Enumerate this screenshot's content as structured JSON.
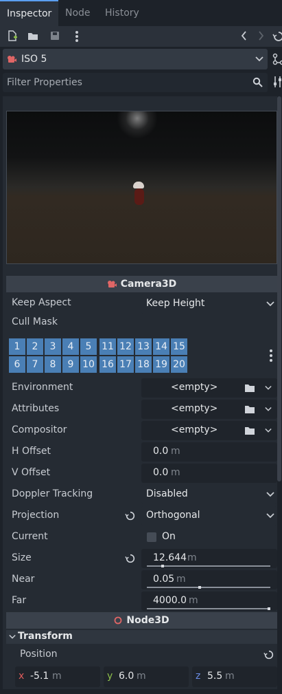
{
  "tabs": [
    "Inspector",
    "Node",
    "History"
  ],
  "node": {
    "name": "ISO 5"
  },
  "filter": {
    "placeholder": "Filter Properties"
  },
  "camera": {
    "header": "Camera3D",
    "keep_aspect": {
      "label": "Keep Aspect",
      "value": "Keep Height"
    },
    "cull_mask": {
      "label": "Cull Mask",
      "layers_row1": [
        "1",
        "2",
        "3",
        "4",
        "5",
        "11",
        "12",
        "13",
        "14",
        "15"
      ],
      "layers_row2": [
        "6",
        "7",
        "8",
        "9",
        "10",
        "16",
        "17",
        "18",
        "19",
        "20"
      ]
    },
    "environment": {
      "label": "Environment",
      "value": "<empty>"
    },
    "attributes": {
      "label": "Attributes",
      "value": "<empty>"
    },
    "compositor": {
      "label": "Compositor",
      "value": "<empty>"
    },
    "h_offset": {
      "label": "H Offset",
      "value": "0.0",
      "unit": "m"
    },
    "v_offset": {
      "label": "V Offset",
      "value": "0.0",
      "unit": "m"
    },
    "doppler": {
      "label": "Doppler Tracking",
      "value": "Disabled"
    },
    "projection": {
      "label": "Projection",
      "value": "Orthogonal"
    },
    "current": {
      "label": "Current",
      "value": "On"
    },
    "size": {
      "label": "Size",
      "value": "12.644",
      "unit": "m"
    },
    "near": {
      "label": "Near",
      "value": "0.05",
      "unit": "m"
    },
    "far": {
      "label": "Far",
      "value": "4000.0",
      "unit": "m"
    }
  },
  "node3d": {
    "header": "Node3D",
    "transform_label": "Transform",
    "position": {
      "label": "Position",
      "x": "-5.1",
      "y": "6.0",
      "z": "5.5",
      "unit": "m",
      "x_axis": "x",
      "y_axis": "y",
      "z_axis": "z"
    }
  },
  "colors": {
    "accent": "#5b9ef1",
    "layer_cell": "#4a7fb5",
    "camera_icon": "#e06666",
    "x_axis": "#e05c5c",
    "y_axis": "#8ec04b",
    "z_axis": "#6b8ee8"
  }
}
